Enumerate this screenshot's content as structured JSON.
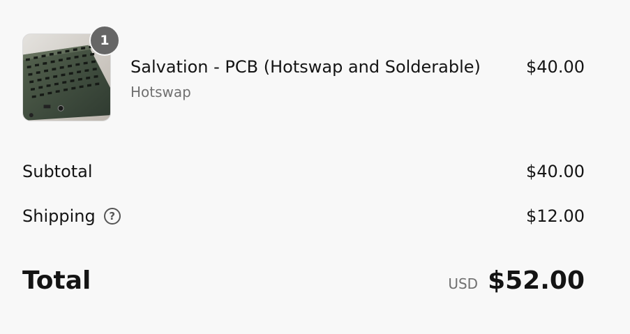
{
  "line_item": {
    "quantity": "1",
    "name": "Salvation - PCB (Hotswap and Solderable)",
    "variant": "Hotswap",
    "price": "$40.00",
    "image_icon": "keyboard-pcb-photo"
  },
  "totals": {
    "subtotal_label": "Subtotal",
    "subtotal_value": "$40.00",
    "shipping_label": "Shipping",
    "shipping_help_icon": "question-circle-icon",
    "shipping_help_glyph": "?",
    "shipping_value": "$12.00",
    "total_label": "Total",
    "currency": "USD",
    "total_value": "$52.00"
  },
  "colors": {
    "background": "#f8f8f8",
    "text": "#141414",
    "muted_text": "#707070",
    "badge": "#666666",
    "pcb_green": "#3d4a3c"
  }
}
